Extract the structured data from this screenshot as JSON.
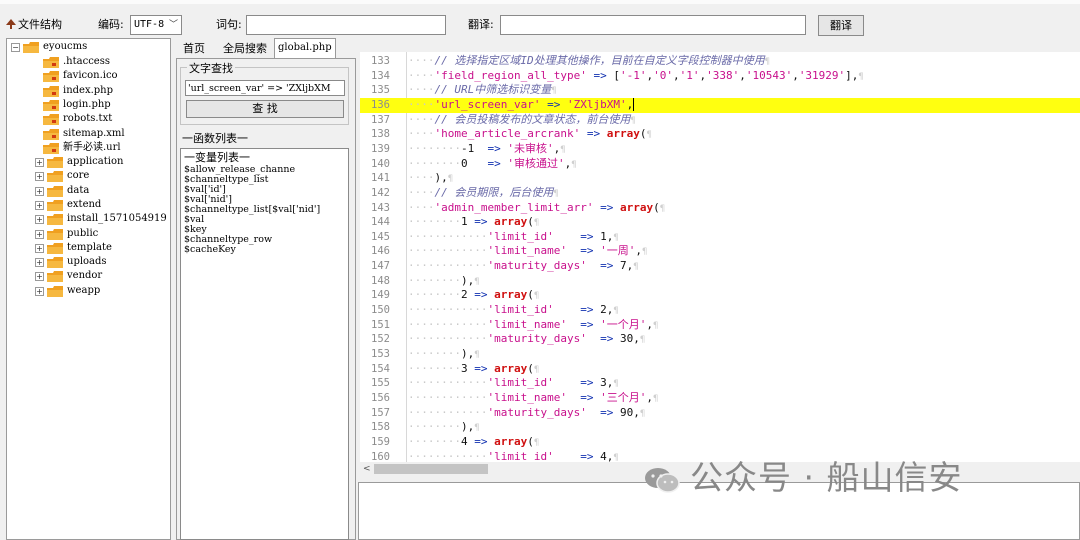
{
  "toolbar": {
    "file_structure_label": "文件结构",
    "encoding_label": "编码:",
    "encoding_value": "UTF-8",
    "word_label": "词句:",
    "word_value": "",
    "translate_label": "翻译:",
    "translate_value": "",
    "translate_button": "翻译"
  },
  "tree": {
    "root": "eyoucms",
    "files": [
      ".htaccess",
      "favicon.ico",
      "index.php",
      "login.php",
      "robots.txt",
      "sitemap.xml",
      "新手必读.url"
    ],
    "folders": [
      "application",
      "core",
      "data",
      "extend",
      "install_1571054919",
      "public",
      "template",
      "uploads",
      "vendor",
      "weapp"
    ]
  },
  "tabs": [
    "首页",
    "全局搜索",
    "global.php"
  ],
  "search": {
    "group_label": "文字查找",
    "input_value": "'url_screen_var' => 'ZXljbXM",
    "button": "查 找"
  },
  "function_list_label": "一函数列表一",
  "variable_list_label": "一变量列表一",
  "variables": [
    "$allow_release_channe",
    "$channeltype_list",
    "$val['id']",
    "$val['nid']",
    "$channeltype_list[$val['nid']",
    "$val",
    "$key",
    "$channeltype_row",
    "$cacheKey"
  ],
  "code": {
    "highlight_line": 136,
    "lines": [
      {
        "n": "133",
        "d": "····",
        "t": [
          [
            "cmt",
            "// 选择指定区域ID处理其他操作，目前在自定义字段控制器中使用"
          ],
          [
            "pil",
            "¶"
          ]
        ]
      },
      {
        "n": "134",
        "d": "····",
        "t": [
          [
            "str",
            "'field_region_all_type'"
          ],
          [
            "op",
            " => "
          ],
          [
            "num",
            "["
          ],
          [
            "str",
            "'-1'"
          ],
          [
            "num",
            ","
          ],
          [
            "str",
            "'0'"
          ],
          [
            "num",
            ","
          ],
          [
            "str",
            "'1'"
          ],
          [
            "num",
            ","
          ],
          [
            "str",
            "'338'"
          ],
          [
            "num",
            ","
          ],
          [
            "str",
            "'10543'"
          ],
          [
            "num",
            ","
          ],
          [
            "str",
            "'31929'"
          ],
          [
            "num",
            "],"
          ],
          [
            "pil",
            "¶"
          ]
        ]
      },
      {
        "n": "135",
        "d": "····",
        "t": [
          [
            "cmt",
            "// URL中筛选标识变量"
          ],
          [
            "pil",
            "¶"
          ]
        ]
      },
      {
        "n": "136",
        "d": "····",
        "t": [
          [
            "str",
            "'url_screen_var'"
          ],
          [
            "op",
            " => "
          ],
          [
            "str",
            "'ZXljbXM'"
          ],
          [
            "num",
            ","
          ],
          [
            "caret",
            ""
          ]
        ]
      },
      {
        "n": "137",
        "d": "····",
        "t": [
          [
            "cmt",
            "// 会员投稿发布的文章状态，前台使用"
          ],
          [
            "pil",
            "¶"
          ]
        ]
      },
      {
        "n": "138",
        "d": "····",
        "t": [
          [
            "str",
            "'home_article_arcrank'"
          ],
          [
            "op",
            " => "
          ],
          [
            "kw",
            "array"
          ],
          [
            "num",
            "("
          ],
          [
            "pil",
            "¶"
          ]
        ]
      },
      {
        "n": "139",
        "d": "········",
        "t": [
          [
            "num",
            "-1"
          ],
          [
            "op",
            "  => "
          ],
          [
            "str",
            "'未审核'"
          ],
          [
            "num",
            ","
          ],
          [
            "pil",
            "¶"
          ]
        ]
      },
      {
        "n": "140",
        "d": "········",
        "t": [
          [
            "num",
            "0"
          ],
          [
            "op",
            "   => "
          ],
          [
            "str",
            "'审核通过'"
          ],
          [
            "num",
            ","
          ],
          [
            "pil",
            "¶"
          ]
        ]
      },
      {
        "n": "141",
        "d": "····",
        "t": [
          [
            "num",
            "),"
          ],
          [
            "pil",
            "¶"
          ]
        ]
      },
      {
        "n": "142",
        "d": "····",
        "t": [
          [
            "cmt",
            "// 会员期限，后台使用"
          ],
          [
            "pil",
            "¶"
          ]
        ]
      },
      {
        "n": "143",
        "d": "····",
        "t": [
          [
            "str",
            "'admin_member_limit_arr'"
          ],
          [
            "op",
            " => "
          ],
          [
            "kw",
            "array"
          ],
          [
            "num",
            "("
          ],
          [
            "pil",
            "¶"
          ]
        ]
      },
      {
        "n": "144",
        "d": "········",
        "t": [
          [
            "num",
            "1"
          ],
          [
            "op",
            " => "
          ],
          [
            "kw",
            "array"
          ],
          [
            "num",
            "("
          ],
          [
            "pil",
            "¶"
          ]
        ]
      },
      {
        "n": "145",
        "d": "············",
        "t": [
          [
            "str",
            "'limit_id'"
          ],
          [
            "op",
            "    => "
          ],
          [
            "num",
            "1,"
          ],
          [
            "pil",
            "¶"
          ]
        ]
      },
      {
        "n": "146",
        "d": "············",
        "t": [
          [
            "str",
            "'limit_name'"
          ],
          [
            "op",
            "  => "
          ],
          [
            "str",
            "'一周'"
          ],
          [
            "num",
            ","
          ],
          [
            "pil",
            "¶"
          ]
        ]
      },
      {
        "n": "147",
        "d": "············",
        "t": [
          [
            "str",
            "'maturity_days'"
          ],
          [
            "op",
            "  => "
          ],
          [
            "num",
            "7,"
          ],
          [
            "pil",
            "¶"
          ]
        ]
      },
      {
        "n": "148",
        "d": "········",
        "t": [
          [
            "num",
            "),"
          ],
          [
            "pil",
            "¶"
          ]
        ]
      },
      {
        "n": "149",
        "d": "········",
        "t": [
          [
            "num",
            "2"
          ],
          [
            "op",
            " => "
          ],
          [
            "kw",
            "array"
          ],
          [
            "num",
            "("
          ],
          [
            "pil",
            "¶"
          ]
        ]
      },
      {
        "n": "150",
        "d": "············",
        "t": [
          [
            "str",
            "'limit_id'"
          ],
          [
            "op",
            "    => "
          ],
          [
            "num",
            "2,"
          ],
          [
            "pil",
            "¶"
          ]
        ]
      },
      {
        "n": "151",
        "d": "············",
        "t": [
          [
            "str",
            "'limit_name'"
          ],
          [
            "op",
            "  => "
          ],
          [
            "str",
            "'一个月'"
          ],
          [
            "num",
            ","
          ],
          [
            "pil",
            "¶"
          ]
        ]
      },
      {
        "n": "152",
        "d": "············",
        "t": [
          [
            "str",
            "'maturity_days'"
          ],
          [
            "op",
            "  => "
          ],
          [
            "num",
            "30,"
          ],
          [
            "pil",
            "¶"
          ]
        ]
      },
      {
        "n": "153",
        "d": "········",
        "t": [
          [
            "num",
            "),"
          ],
          [
            "pil",
            "¶"
          ]
        ]
      },
      {
        "n": "154",
        "d": "········",
        "t": [
          [
            "num",
            "3"
          ],
          [
            "op",
            " => "
          ],
          [
            "kw",
            "array"
          ],
          [
            "num",
            "("
          ],
          [
            "pil",
            "¶"
          ]
        ]
      },
      {
        "n": "155",
        "d": "············",
        "t": [
          [
            "str",
            "'limit_id'"
          ],
          [
            "op",
            "    => "
          ],
          [
            "num",
            "3,"
          ],
          [
            "pil",
            "¶"
          ]
        ]
      },
      {
        "n": "156",
        "d": "············",
        "t": [
          [
            "str",
            "'limit_name'"
          ],
          [
            "op",
            "  => "
          ],
          [
            "str",
            "'三个月'"
          ],
          [
            "num",
            ","
          ],
          [
            "pil",
            "¶"
          ]
        ]
      },
      {
        "n": "157",
        "d": "············",
        "t": [
          [
            "str",
            "'maturity_days'"
          ],
          [
            "op",
            "  => "
          ],
          [
            "num",
            "90,"
          ],
          [
            "pil",
            "¶"
          ]
        ]
      },
      {
        "n": "158",
        "d": "········",
        "t": [
          [
            "num",
            "),"
          ],
          [
            "pil",
            "¶"
          ]
        ]
      },
      {
        "n": "159",
        "d": "········",
        "t": [
          [
            "num",
            "4"
          ],
          [
            "op",
            " => "
          ],
          [
            "kw",
            "array"
          ],
          [
            "num",
            "("
          ],
          [
            "pil",
            "¶"
          ]
        ]
      },
      {
        "n": "160",
        "d": "············",
        "t": [
          [
            "str",
            "'limit_id'"
          ],
          [
            "op",
            "    => "
          ],
          [
            "num",
            "4,"
          ],
          [
            "pil",
            "¶"
          ]
        ]
      }
    ]
  },
  "watermark": "公众号 · 船山信安",
  "colors": {
    "highlight": "#ffff10",
    "string": "#c8108c",
    "keyword": "#d01010",
    "comment": "#6a6aa8",
    "folder": "#f0a020"
  }
}
